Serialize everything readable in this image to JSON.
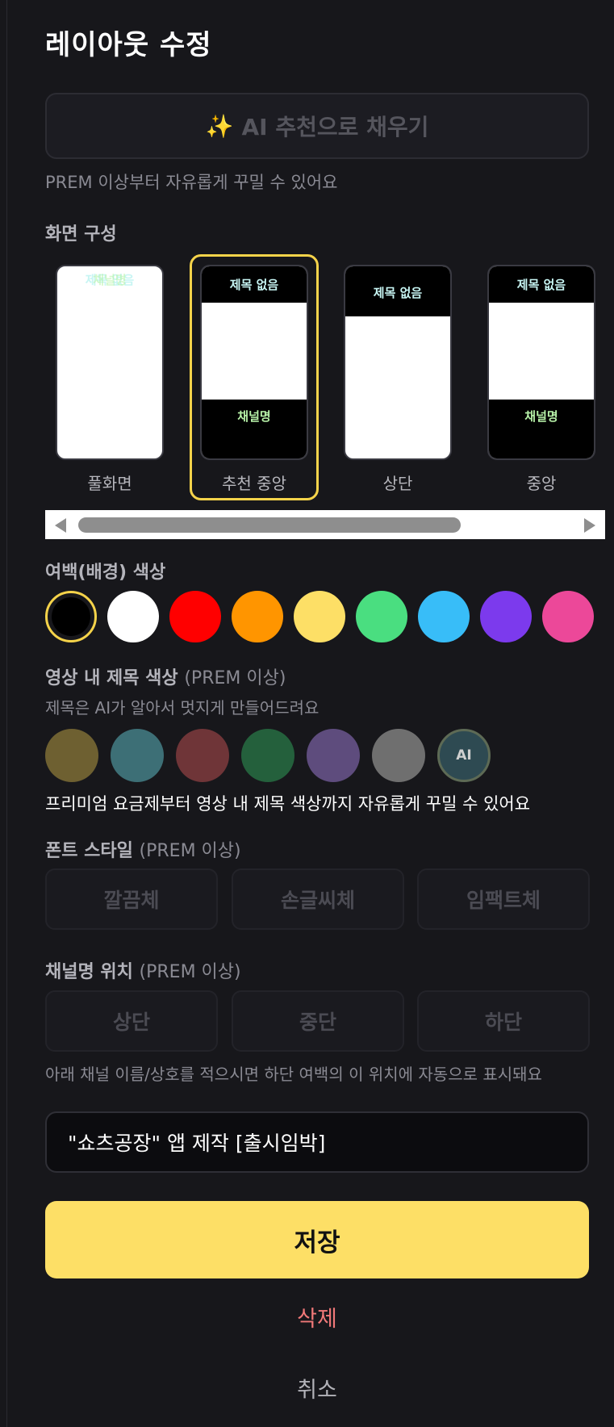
{
  "modal": {
    "title": "레이아웃 수정",
    "ai_button": {
      "icon": "sparkles-icon",
      "icon_char": "✨",
      "label": "AI 추천으로 채우기"
    },
    "prem_hint": "PREM 이상부터 자유롭게 꾸밀 수 있어요"
  },
  "layout_section": {
    "title": "화면 구성",
    "options": [
      {
        "label": "풀화면",
        "title_text": "제목 없음",
        "channel_text": "채널명",
        "selected": false
      },
      {
        "label": "추천 중앙",
        "title_text": "제목 없음",
        "channel_text": "채널명",
        "selected": true
      },
      {
        "label": "상단",
        "title_text": "제목 없음",
        "channel_text": "",
        "selected": false
      },
      {
        "label": "중앙",
        "title_text": "제목 없음",
        "channel_text": "채널명",
        "selected": false
      }
    ]
  },
  "bg_color_section": {
    "title": "여백(배경) 색상",
    "colors": [
      "#000000",
      "#ffffff",
      "#ff0000",
      "#ff9500",
      "#fddf66",
      "#4ade80",
      "#38bdf8",
      "#7c3aed",
      "#ec4899"
    ],
    "selected_index": 0
  },
  "title_color_section": {
    "title": "영상 내 제목 색상",
    "title_sub": "(PREM 이상)",
    "description": "제목은 AI가 알아서 멋지게 만들어드려요",
    "colors": [
      "#6e6031",
      "#3d6f76",
      "#6f3538",
      "#24603c",
      "#5e4c7d",
      "#6f6f6f"
    ],
    "ai_swatch_label": "AI",
    "note": "프리미엄 요금제부터 영상 내 제목 색상까지 자유롭게 꾸밀 수 있어요"
  },
  "font_section": {
    "title": "폰트 스타일",
    "title_sub": "(PREM 이상)",
    "options": [
      "깔끔체",
      "손글씨체",
      "임팩트체"
    ]
  },
  "channel_pos_section": {
    "title": "채널명 위치",
    "title_sub": "(PREM 이상)",
    "options": [
      "상단",
      "중단",
      "하단"
    ],
    "hint": "아래 채널 이름/상호를 적으시면 하단 여백의 이 위치에 자동으로 표시돼요"
  },
  "channel_input": {
    "value": "\"쇼츠공장\" 앱 제작 [출시임박]"
  },
  "actions": {
    "save": "저장",
    "delete": "삭제",
    "cancel": "취소"
  }
}
